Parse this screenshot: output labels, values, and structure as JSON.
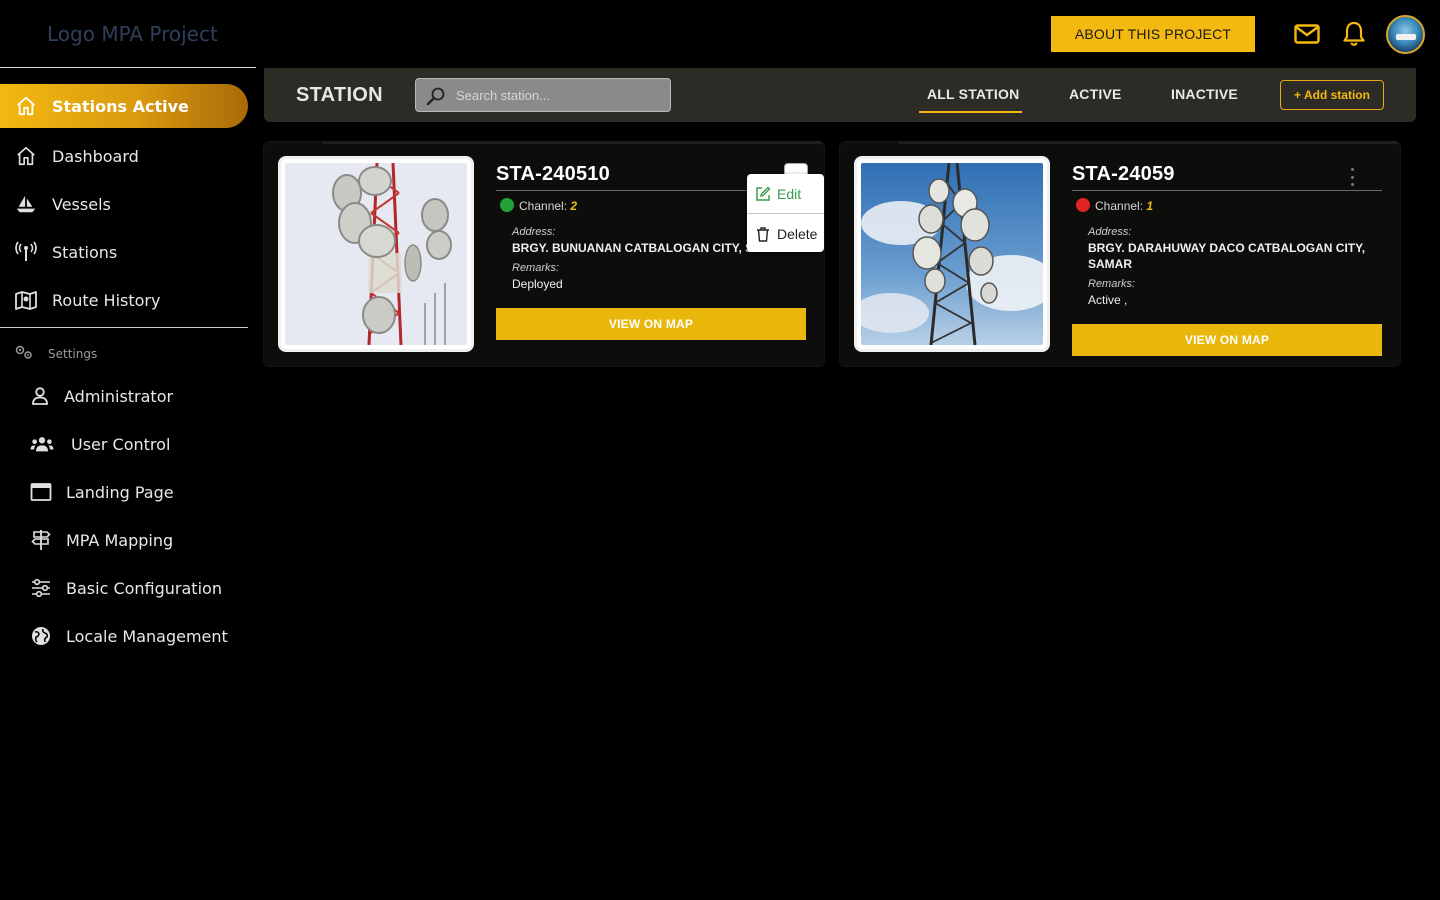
{
  "app": {
    "logo_text": "Logo MPA Project",
    "about_label": "ABOUT THIS PROJECT"
  },
  "icons": {
    "mail": "mail-icon",
    "bell": "bell-icon",
    "avatar": "avatar"
  },
  "colors": {
    "accent": "#f3b90f",
    "active_status": "#22a33a",
    "inactive_status": "#e02424",
    "station_bar": "#2c2b25"
  },
  "sidebar": {
    "active": {
      "label": "Stations Active",
      "icon": "home-icon"
    },
    "items": [
      {
        "label": "Dashboard",
        "icon": "home-icon"
      },
      {
        "label": "Vessels",
        "icon": "sailboat-icon"
      },
      {
        "label": "Stations",
        "icon": "antenna-icon"
      },
      {
        "label": "Route History",
        "icon": "map-icon"
      }
    ],
    "settings_label": "Settings",
    "settings_items": [
      {
        "label": "Administrator",
        "icon": "user-icon"
      },
      {
        "label": "User Control",
        "icon": "users-icon"
      },
      {
        "label": "Landing Page",
        "icon": "window-icon"
      },
      {
        "label": "MPA Mapping",
        "icon": "signpost-icon"
      },
      {
        "label": "Basic Configuration",
        "icon": "sliders-icon"
      },
      {
        "label": "Locale Management",
        "icon": "globe-icon"
      }
    ]
  },
  "station_header": {
    "title": "STATION",
    "search_placeholder": "Search station...",
    "tabs": [
      {
        "label": "ALL STATION",
        "active": true
      },
      {
        "label": "ACTIVE",
        "active": false
      },
      {
        "label": "INACTIVE",
        "active": false
      }
    ],
    "add_label": "+ Add station"
  },
  "cards": [
    {
      "id": "STA-240510",
      "status": "active",
      "channel_label": "Channel:",
      "channel": "2",
      "address_label": "Address:",
      "address": "BRGY. BUNUANAN CATBALOGAN CITY, SAMAR",
      "remarks_label": "Remarks:",
      "remarks": "Deployed",
      "button": "VIEW ON MAP"
    },
    {
      "id": "STA-24059",
      "status": "inactive",
      "channel_label": "Channel:",
      "channel": "1",
      "address_label": "Address:",
      "address": "BRGY. DARAHUWAY DACO CATBALOGAN CITY, SAMAR",
      "remarks_label": "Remarks:",
      "remarks": "Active ,",
      "button": "VIEW ON MAP"
    }
  ],
  "context_menu": {
    "items": [
      {
        "label": "Edit",
        "icon": "edit-icon",
        "color": "#3a9b4e"
      },
      {
        "label": "Delete",
        "icon": "trash-icon",
        "color": "#222222"
      }
    ]
  }
}
